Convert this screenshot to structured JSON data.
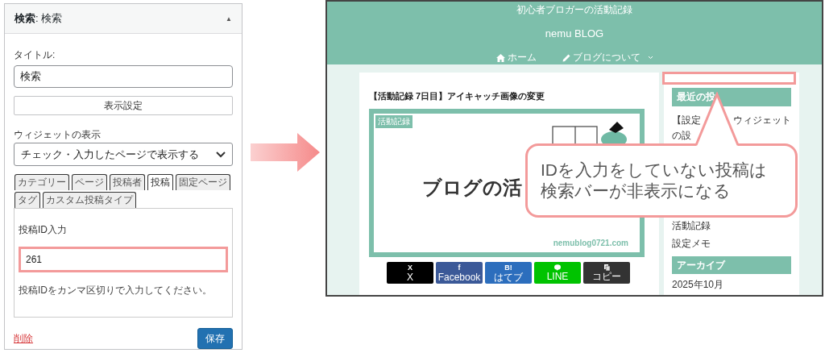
{
  "widget_panel": {
    "header": "**検索**: 検索",
    "collapse_glyph": "▲",
    "title_label": "タイトル:",
    "title_value": "検索",
    "display_settings_button": "表示設定",
    "visibility_label": "ウィジェットの表示",
    "visibility_value": "チェック・入力したページで表示する",
    "tabs": [
      {
        "label": "カテゴリー",
        "selected": false
      },
      {
        "label": "ページ",
        "selected": false
      },
      {
        "label": "投稿者",
        "selected": false
      },
      {
        "label": "投稿",
        "selected": true
      },
      {
        "label": "固定ページ",
        "selected": false
      },
      {
        "label": "タグ",
        "selected": false
      },
      {
        "label": "カスタム投稿タイプ",
        "selected": false
      }
    ],
    "post_id_label": "投稿ID入力",
    "post_id_value": "261",
    "post_id_highlighted": true,
    "help_text": "投稿IDをカンマ区切りで入力してください。",
    "delete_link": "削除",
    "save_button": "保存"
  },
  "blog": {
    "tagline": "初心者ブロガーの活動記録",
    "title": "nemu BLOG",
    "nav": [
      {
        "kind": "home",
        "label": "ホーム",
        "dropdown": false
      },
      {
        "kind": "pencil",
        "label": "ブログについて",
        "dropdown": true
      }
    ],
    "article": {
      "title": "【活動記録 7日目】アイキャッチ画像の変更",
      "image": {
        "tag": "活動記録",
        "heading": "ブログの活",
        "url": "nemublog0721.com"
      },
      "share_buttons": [
        {
          "kind": "x",
          "icon": "X",
          "label": "X",
          "color": "#000000"
        },
        {
          "kind": "facebook",
          "icon": "f",
          "label": "Facebook",
          "color": "#3b5998"
        },
        {
          "kind": "hatena",
          "icon": "B!",
          "label": "はてブ",
          "color": "#2c6ebd"
        },
        {
          "kind": "line",
          "label": "LINE",
          "color": "#00c300"
        },
        {
          "kind": "copy",
          "label": "コピー",
          "color": "#333333"
        }
      ]
    },
    "sidebar": {
      "hidden_widget_highlighted": true,
      "recent_heading": "最近の投",
      "first_post_parts": [
        "【設定",
        "ウィジェット"
      ],
      "first_post_second_line": "の設",
      "other_posts": [
        "活動記録",
        "設定メモ"
      ],
      "archive_heading": "アーカイブ",
      "archives": [
        "2025年10月"
      ]
    }
  },
  "callout": {
    "lines": [
      "IDを入力をしていない投稿は",
      "検索バーが非表示になる"
    ]
  }
}
